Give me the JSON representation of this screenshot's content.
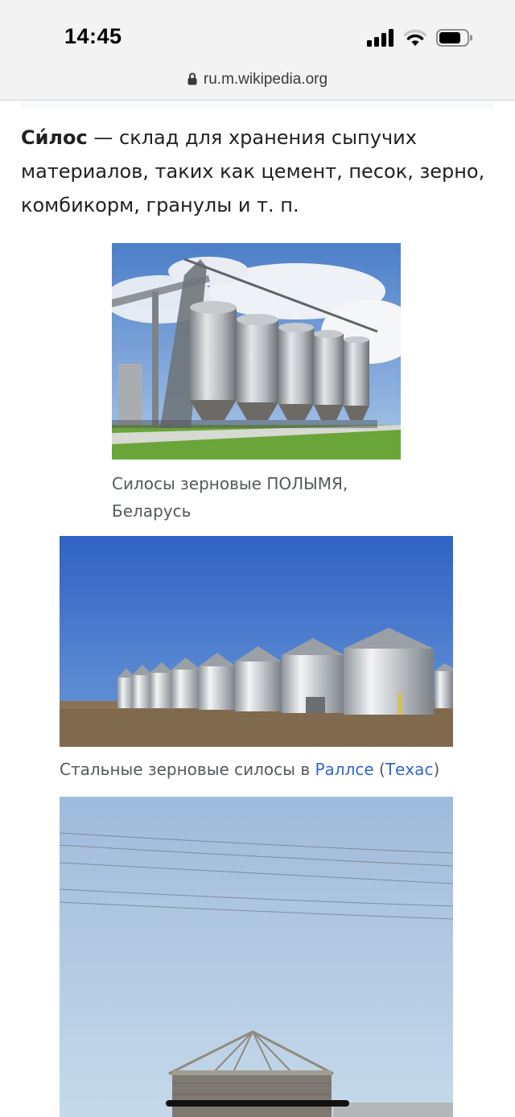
{
  "status_bar": {
    "time": "14:45",
    "icons": [
      "signal-icon",
      "wifi-icon",
      "battery-icon"
    ]
  },
  "browser": {
    "url": "ru.m.wikipedia.org"
  },
  "article": {
    "term": "Си́лос",
    "definition": " — склад для хранения сыпучих материалов, таких как цемент, песок, зерно, комбикорм, гранулы и т. п."
  },
  "figures": {
    "fig1": {
      "caption": "Силосы зерновые ПОЛЫМЯ, Беларусь"
    },
    "fig2": {
      "caption_prefix": "Стальные зерновые силосы в ",
      "link1": "Раллсе",
      "middle": " (",
      "link2": "Техас",
      "suffix": ")"
    }
  },
  "colors": {
    "link": "#3366cc",
    "caption": "#54595d",
    "text": "#202122"
  }
}
